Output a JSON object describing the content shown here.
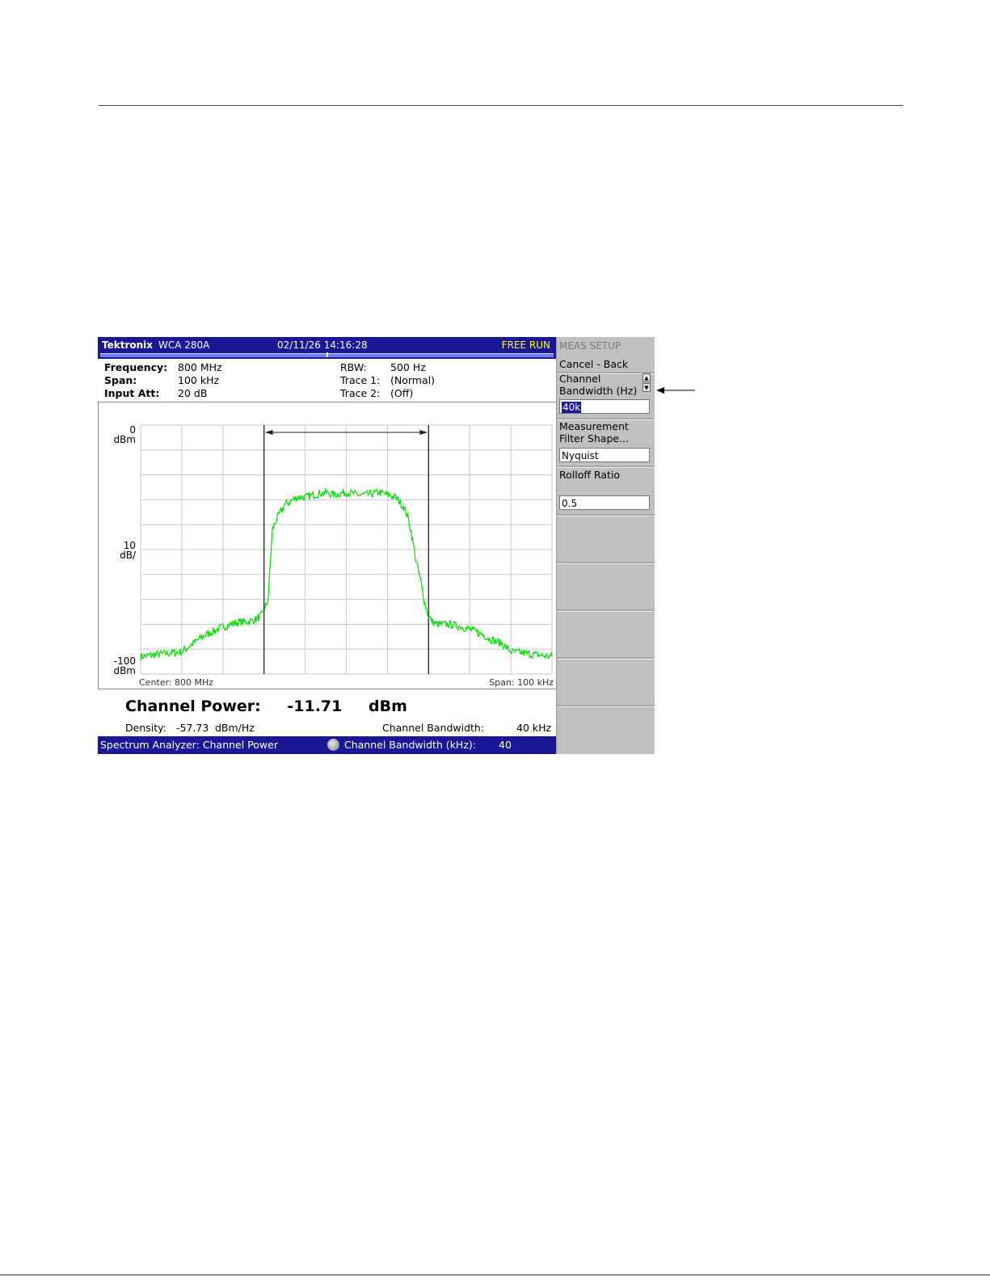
{
  "titlebar": {
    "brand": "Tektronix",
    "model": "WCA 280A",
    "datetime": "02/11/26 14:16:28",
    "run_state": "FREE RUN"
  },
  "settings": {
    "frequency_label": "Frequency:",
    "frequency_value": "800 MHz",
    "span_label": "Span:",
    "span_value": "100 kHz",
    "input_att_label": "Input Att:",
    "input_att_value": "20 dB",
    "rbw_label": "RBW:",
    "rbw_value": "500 Hz",
    "trace1_label": "Trace 1:",
    "trace1_value": "(Normal)",
    "trace2_label": "Trace 2:",
    "trace2_value": "(Off)"
  },
  "plot": {
    "ref_level": "0",
    "ref_unit": "dBm",
    "scale": "10",
    "scale_unit": "dB/",
    "bottom_level": "-100",
    "bottom_unit": "dBm",
    "center_label": "Center: 800 MHz",
    "span_label": "Span: 100 kHz",
    "trace_color": "#00e000"
  },
  "results": {
    "channel_power_label": "Channel Power:",
    "channel_power_value": "-11.71",
    "channel_power_unit": "dBm",
    "density_label": "Density:",
    "density_value": "-57.73",
    "density_unit": "dBm/Hz",
    "bandwidth_label": "Channel Bandwidth:",
    "bandwidth_value": "40 kHz"
  },
  "statusbar": {
    "mode": "Spectrum Analyzer: Channel Power",
    "knob_label": "Channel Bandwidth (kHz):",
    "knob_value": "40"
  },
  "menu": {
    "title": "MEAS SETUP",
    "cancel": "Cancel - Back",
    "channel_bw_line1": "Channel",
    "channel_bw_line2": "Bandwidth (Hz)",
    "channel_bw_value": "40k",
    "filter_line1": "Measurement",
    "filter_line2": "Filter Shape...",
    "filter_value": "Nyquist",
    "rolloff_label": "Rolloff Ratio",
    "rolloff_value": "0.5"
  },
  "chart_data": {
    "type": "line",
    "x_unit": "kHz offset from center",
    "xlim": [
      -50,
      50
    ],
    "ylim": [
      -100,
      0
    ],
    "grid": true,
    "channel_bandwidth_khz": 40,
    "series": [
      {
        "x": [
          -50,
          -45,
          -40,
          -35,
          -30,
          -28,
          -26,
          -24,
          -22,
          -21,
          -20,
          -19,
          -18,
          -17,
          -15,
          -12,
          -10,
          -8,
          -5,
          -3,
          0,
          3,
          5,
          8,
          10,
          12,
          14,
          15,
          16,
          17,
          18,
          19,
          20,
          21,
          22,
          25,
          28,
          30,
          33,
          35,
          38,
          40,
          45,
          50
        ],
        "y": [
          -93,
          -92,
          -91,
          -85,
          -81,
          -80,
          -79,
          -79,
          -78,
          -77,
          -75,
          -70,
          -42,
          -38,
          -32,
          -29,
          -29,
          -28,
          -27,
          -28,
          -27,
          -28,
          -28,
          -27,
          -28,
          -29,
          -33,
          -37,
          -45,
          -55,
          -62,
          -71,
          -77,
          -79,
          -80,
          -80,
          -81,
          -82,
          -84,
          -86,
          -88,
          -91,
          -92,
          -93
        ]
      }
    ]
  }
}
